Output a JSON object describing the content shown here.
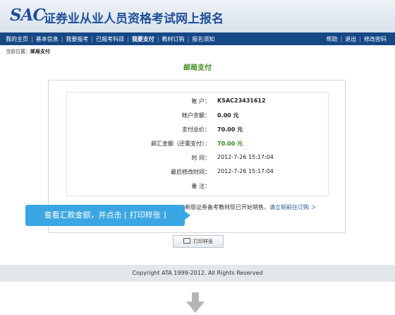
{
  "header": {
    "logo": "SAC",
    "title": "证券业从业人员资格考试网上报名"
  },
  "nav": {
    "left_items": [
      {
        "label": "我的主页"
      },
      {
        "label": "基本信息"
      },
      {
        "label": "我要报考"
      },
      {
        "label": "已报考科目"
      },
      {
        "label": "我要支付",
        "active": true
      },
      {
        "label": "教材订购"
      },
      {
        "label": "报名须知"
      }
    ],
    "right_items": [
      {
        "label": "帮助"
      },
      {
        "label": "退出"
      },
      {
        "label": "修改密码"
      }
    ]
  },
  "breadcrumb": {
    "prefix": "当前位置：",
    "current": "邮局支付"
  },
  "page_title": "邮局支付",
  "details": [
    {
      "label": "帐      户：",
      "value": "KSAC23431612",
      "style": "bold"
    },
    {
      "label": "帐户余额：",
      "value": "0.00 元",
      "style": "bold"
    },
    {
      "label": "支付总价：",
      "value": "70.00 元",
      "style": "bold"
    },
    {
      "label": "邮汇金额（还需支付）：",
      "value": "70.00 元",
      "style": "green"
    },
    {
      "label": "时      间：",
      "value": "2012-7-26 15:17:04",
      "style": "normal"
    },
    {
      "label": "最后修改时间：",
      "value": "2012-7-26 15:17:04",
      "style": "normal"
    },
    {
      "label": "备      注：",
      "value": "",
      "style": "normal"
    }
  ],
  "notice": {
    "text": "新版证券备考教材现已开始销售，",
    "link": "请立刻前往订购 ＞"
  },
  "tooltip": "查看汇款金额，并点击 [ 打印样张 ]",
  "print_button": "打印样张",
  "footer": "Copyright ATA 1999-2012. All Rights Reserved",
  "colors": {
    "brand": "#164886",
    "accent_green": "#2f8a12",
    "tooltip": "#3aa6e3"
  },
  "icons": {
    "print": "printer-icon",
    "next_step": "arrow-down-icon"
  }
}
